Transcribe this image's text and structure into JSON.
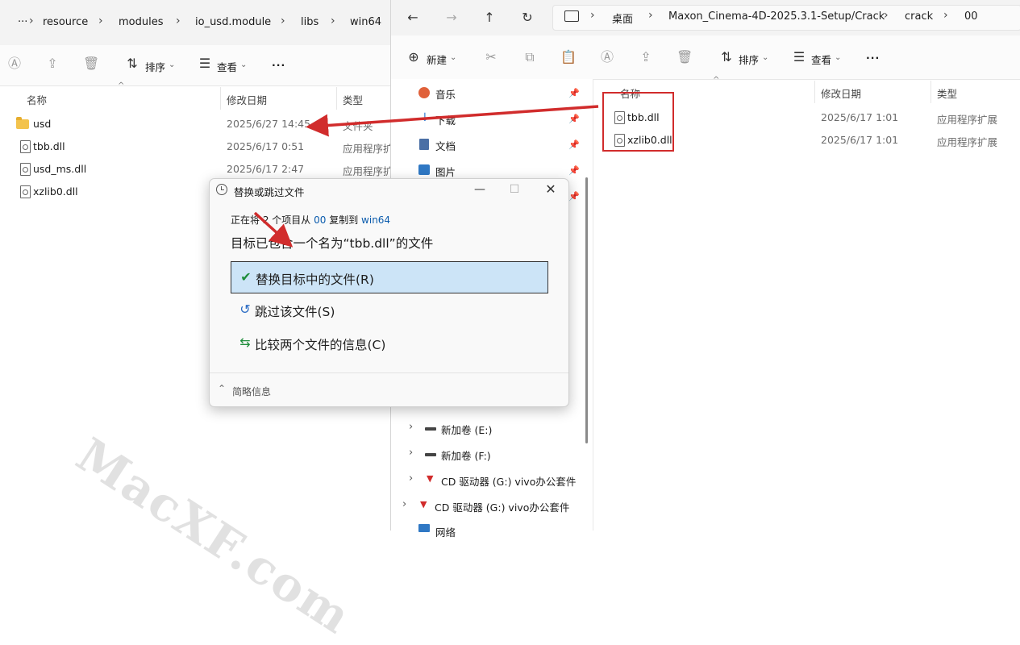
{
  "left_window": {
    "breadcrumb": [
      "···",
      "resource",
      "modules",
      "io_usd.module",
      "libs",
      "win64"
    ],
    "toolbar": {
      "sort_label": "排序",
      "view_label": "查看",
      "more_label": "···"
    },
    "columns": {
      "name": "名称",
      "date": "修改日期",
      "type": "类型"
    },
    "rows": [
      {
        "name": "usd",
        "date": "2025/6/27 14:45",
        "type": "文件夹",
        "kind": "folder"
      },
      {
        "name": "tbb.dll",
        "date": "2025/6/17 0:51",
        "type": "应用程序扩展",
        "kind": "dll"
      },
      {
        "name": "usd_ms.dll",
        "date": "2025/6/17 2:47",
        "type": "应用程序扩展",
        "kind": "dll"
      },
      {
        "name": "xzlib0.dll",
        "date": "",
        "type": "",
        "kind": "dll"
      }
    ]
  },
  "right_window": {
    "breadcrumb": [
      "桌面",
      "Maxon_Cinema-4D-2025.3.1-Setup/Crack",
      "crack",
      "00"
    ],
    "toolbar": {
      "new_label": "新建",
      "sort_label": "排序",
      "view_label": "查看",
      "more_label": "···"
    },
    "nav_items": [
      "音乐",
      "下载",
      "文档",
      "图片"
    ],
    "drives": [
      "新加卷 (E:)",
      "新加卷 (F:)",
      "CD 驱动器 (G:) vivo办公套件",
      "CD 驱动器 (G:) vivo办公套件",
      "网络"
    ],
    "columns": {
      "name": "名称",
      "date": "修改日期",
      "type": "类型"
    },
    "rows": [
      {
        "name": "tbb.dll",
        "date": "2025/6/17 1:01",
        "type": "应用程序扩展"
      },
      {
        "name": "xzlib0.dll",
        "date": "2025/6/17 1:01",
        "type": "应用程序扩展"
      }
    ]
  },
  "dialog": {
    "title": "替换或跳过文件",
    "progress_prefix": "正在将 2 个项目从",
    "source": "00",
    "copy_to": "复制到",
    "dest": "win64",
    "message": "目标已包含一个名为“tbb.dll”的文件",
    "options": {
      "replace": "替换目标中的文件(R)",
      "skip": "跳过该文件(S)",
      "compare": "比较两个文件的信息(C)"
    },
    "fewer_details": "简略信息"
  },
  "watermark": "MacXF.com",
  "colors": {
    "arrow": "#d12c2c",
    "highlight": "#cce4f7",
    "link": "#0b5cad"
  }
}
